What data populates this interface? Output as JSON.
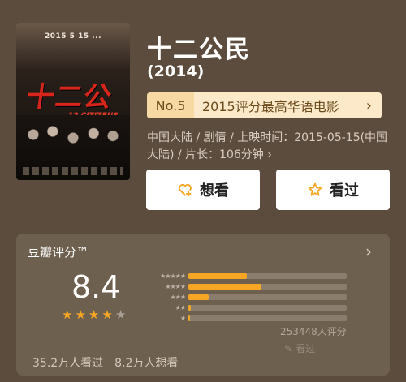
{
  "movie": {
    "title": "十二公民",
    "year": "(2014)",
    "rank_no": "No.5",
    "rank_text": "2015评分最高华语电影",
    "meta": "中国大陆 / 剧情 / 上映时间：2015-05-15(中国大陆) / 片长：106分钟 ›",
    "poster": {
      "date_line": "2015 5 15 ...",
      "title": "十二公民",
      "subtitle": "12 CITIZENS"
    }
  },
  "actions": {
    "want_label": "想看",
    "seen_label": "看过"
  },
  "rating": {
    "label": "豆瓣评分™",
    "score": "8.4",
    "stars_filled": 4,
    "stars_total": 5,
    "distribution": [
      {
        "stars": 5,
        "fraction": 0.37
      },
      {
        "stars": 4,
        "fraction": 0.46
      },
      {
        "stars": 3,
        "fraction": 0.13
      },
      {
        "stars": 2,
        "fraction": 0.015
      },
      {
        "stars": 1,
        "fraction": 0.01
      }
    ],
    "count": "253448人评分",
    "seen_hint": "看过",
    "seen_count": "35.2万人看过",
    "want_count": "8.2万人想看"
  },
  "colors": {
    "background": "#5c4c3d",
    "accent": "#f6a623",
    "rank_bg": "#fbe9c9"
  }
}
